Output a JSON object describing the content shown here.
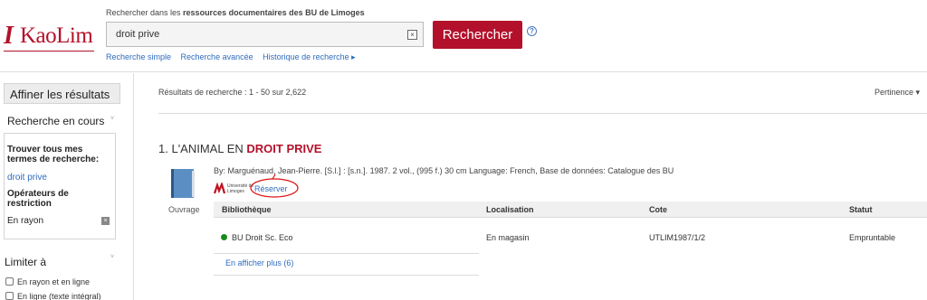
{
  "header": {
    "logo_text": "KaoLim",
    "search_caption_prefix": "Rechercher dans les ",
    "search_caption_bold": "ressources documentaires des BU de Limoges",
    "search_value": "droit prive",
    "clear_symbol": "×",
    "search_button": "Rechercher",
    "help_symbol": "?",
    "links": [
      "Recherche simple",
      "Recherche avancée",
      "Historique de recherche ▸"
    ],
    "brand_color": "#b3112b"
  },
  "sidebar": {
    "title": "Affiner les résultats",
    "current_search_heading": "Recherche en cours",
    "find_all_label": "Trouver tous mes termes de recherche:",
    "search_term": "droit prive",
    "restriction_label": "Opérateurs de restriction",
    "restriction_value": "En rayon",
    "limit_heading": "Limiter à",
    "limits": [
      "En rayon et en ligne",
      "En ligne (texte intégral)"
    ]
  },
  "main": {
    "results_count": "Résultats de recherche : 1 - 50 sur 2,622",
    "sort": "Pertinence ▾",
    "result": {
      "number": "1.",
      "title_prefix": "L'ANIMAL EN ",
      "title_highlight": "DROIT PRIVE",
      "byline": "By: Marguénaud, Jean-Pierre. [S.l.] : [s.n.]. 1987. 2 vol., (995 f.) 30 cm Language: French, Base de données: Catalogue des BU",
      "type": "Ouvrage",
      "univ_logo_text": "Université de Limoges",
      "reserve": "Réserver",
      "holdings": {
        "columns": [
          "Bibliothèque",
          "Localisation",
          "Cote",
          "Statut"
        ],
        "rows": [
          {
            "library": "BU Droit Sc. Eco",
            "location": "En magasin",
            "call_number": "UTLIM1987/1/2",
            "status": "Empruntable",
            "status_color": "#1a8a1a"
          }
        ],
        "more": "En afficher plus (6)"
      }
    }
  }
}
